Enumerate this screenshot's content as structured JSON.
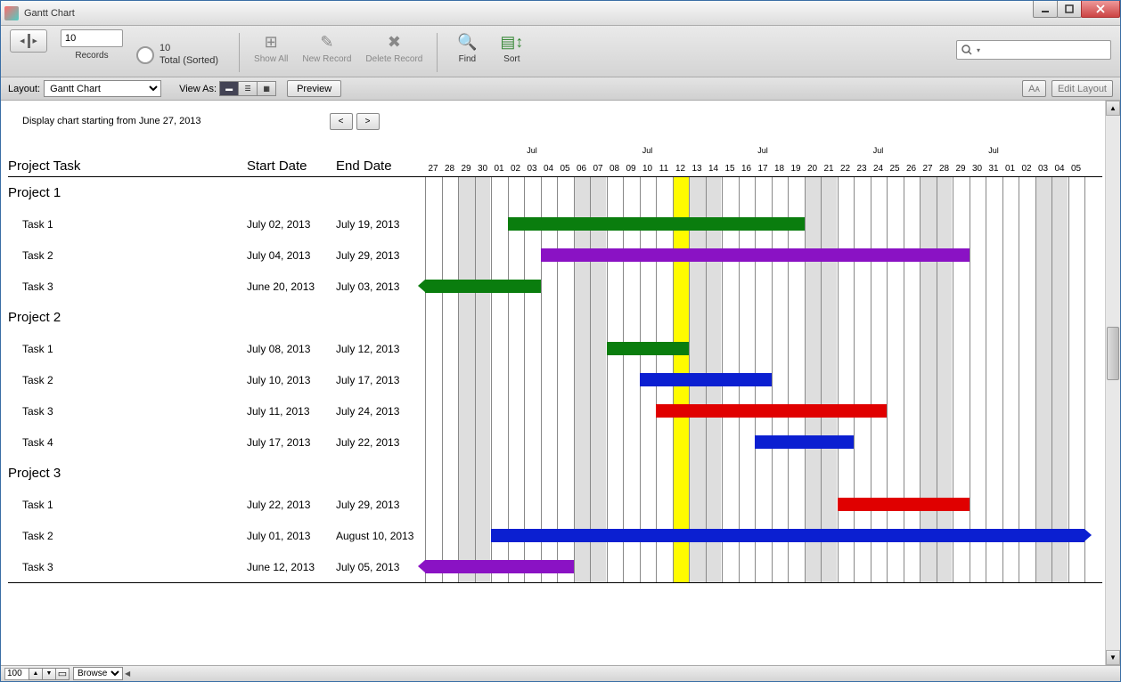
{
  "window": {
    "title": "Gantt Chart"
  },
  "toolbar": {
    "record_input": "10",
    "records_label": "Records",
    "total_count": "10",
    "total_sorted": "Total (Sorted)",
    "show_all": "Show All",
    "new_record": "New Record",
    "delete_record": "Delete Record",
    "find": "Find",
    "sort": "Sort"
  },
  "layout_bar": {
    "layout_label": "Layout:",
    "layout_value": "Gantt Chart",
    "view_as": "View As:",
    "preview": "Preview",
    "edit_layout": "Edit Layout",
    "aa": "Aᴀ"
  },
  "chart": {
    "start_label": "Display chart starting from June 27, 2013",
    "prev": "<",
    "next": ">",
    "col_task": "Project Task",
    "col_start": "Start Date",
    "col_end": "End Date",
    "day_labels": [
      "27",
      "28",
      "29",
      "30",
      "01",
      "02",
      "03",
      "04",
      "05",
      "06",
      "07",
      "08",
      "09",
      "10",
      "11",
      "12",
      "13",
      "14",
      "15",
      "16",
      "17",
      "18",
      "19",
      "20",
      "21",
      "22",
      "23",
      "24",
      "25",
      "26",
      "27",
      "28",
      "29",
      "30",
      "31",
      "01",
      "02",
      "03",
      "04",
      "05"
    ],
    "month_markers": [
      {
        "text": "Jul",
        "pos": 6
      },
      {
        "text": "Jul",
        "pos": 13
      },
      {
        "text": "Jul",
        "pos": 20
      },
      {
        "text": "Jul",
        "pos": 27
      },
      {
        "text": "Jul",
        "pos": 34
      }
    ]
  },
  "rows": [
    {
      "type": "header",
      "name": "Project 1"
    },
    {
      "type": "task",
      "name": "Task 1",
      "start": "July 02, 2013",
      "end": "July 19, 2013",
      "bar": {
        "from": 5,
        "to": 23,
        "color": "#0a7d0e"
      }
    },
    {
      "type": "task",
      "name": "Task 2",
      "start": "July 04, 2013",
      "end": "July 29, 2013",
      "bar": {
        "from": 7,
        "to": 33,
        "color": "#8a12c4"
      }
    },
    {
      "type": "task",
      "name": "Task 3",
      "start": "June 20, 2013",
      "end": "July 03, 2013",
      "bar": {
        "from": 0,
        "to": 7,
        "color": "#0a7d0e",
        "arrowL": true
      }
    },
    {
      "type": "header",
      "name": "Project 2"
    },
    {
      "type": "task",
      "name": "Task 1",
      "start": "July 08, 2013",
      "end": "July 12, 2013",
      "bar": {
        "from": 11,
        "to": 16,
        "color": "#0a7d0e"
      }
    },
    {
      "type": "task",
      "name": "Task 2",
      "start": "July 10, 2013",
      "end": "July 17, 2013",
      "bar": {
        "from": 13,
        "to": 21,
        "color": "#0b1fd1"
      }
    },
    {
      "type": "task",
      "name": "Task 3",
      "start": "July 11, 2013",
      "end": "July 24, 2013",
      "bar": {
        "from": 14,
        "to": 28,
        "color": "#e00000"
      }
    },
    {
      "type": "task",
      "name": "Task 4",
      "start": "July 17, 2013",
      "end": "July 22, 2013",
      "bar": {
        "from": 20,
        "to": 26,
        "color": "#0b1fd1"
      }
    },
    {
      "type": "header",
      "name": "Project 3"
    },
    {
      "type": "task",
      "name": "Task 1",
      "start": "July 22, 2013",
      "end": "July 29, 2013",
      "bar": {
        "from": 25,
        "to": 33,
        "color": "#e00000"
      }
    },
    {
      "type": "task",
      "name": "Task 2",
      "start": "July 01, 2013",
      "end": "August 10, 2013",
      "bar": {
        "from": 4,
        "to": 40,
        "color": "#0b1fd1",
        "arrowR": true
      }
    },
    {
      "type": "task",
      "name": "Task 3",
      "start": "June 12, 2013",
      "end": "July 05, 2013",
      "bar": {
        "from": 0,
        "to": 9,
        "color": "#8a12c4",
        "arrowL": true
      }
    }
  ],
  "footer": {
    "zoom": "100",
    "mode": "Browse"
  },
  "chart_data": {
    "type": "gantt",
    "title": "Gantt Chart",
    "start_date": "2013-06-27",
    "today": "2013-07-12",
    "x": [
      "2013-06-27",
      "2013-08-05"
    ],
    "tasks": [
      {
        "project": "Project 1",
        "task": "Task 1",
        "start": "2013-07-02",
        "end": "2013-07-19",
        "color": "green"
      },
      {
        "project": "Project 1",
        "task": "Task 2",
        "start": "2013-07-04",
        "end": "2013-07-29",
        "color": "purple"
      },
      {
        "project": "Project 1",
        "task": "Task 3",
        "start": "2013-06-20",
        "end": "2013-07-03",
        "color": "green"
      },
      {
        "project": "Project 2",
        "task": "Task 1",
        "start": "2013-07-08",
        "end": "2013-07-12",
        "color": "green"
      },
      {
        "project": "Project 2",
        "task": "Task 2",
        "start": "2013-07-10",
        "end": "2013-07-17",
        "color": "blue"
      },
      {
        "project": "Project 2",
        "task": "Task 3",
        "start": "2013-07-11",
        "end": "2013-07-24",
        "color": "red"
      },
      {
        "project": "Project 2",
        "task": "Task 4",
        "start": "2013-07-17",
        "end": "2013-07-22",
        "color": "blue"
      },
      {
        "project": "Project 3",
        "task": "Task 1",
        "start": "2013-07-22",
        "end": "2013-07-29",
        "color": "red"
      },
      {
        "project": "Project 3",
        "task": "Task 2",
        "start": "2013-07-01",
        "end": "2013-08-10",
        "color": "blue"
      },
      {
        "project": "Project 3",
        "task": "Task 3",
        "start": "2013-06-12",
        "end": "2013-07-05",
        "color": "purple"
      }
    ]
  }
}
